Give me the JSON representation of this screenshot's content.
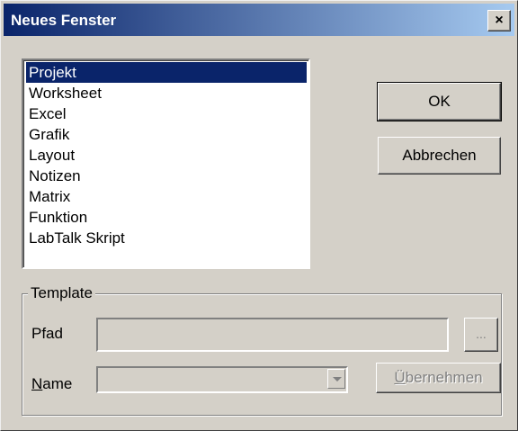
{
  "window": {
    "title": "Neues Fenster",
    "close_symbol": "×"
  },
  "list": {
    "items": [
      {
        "label": "Projekt",
        "selected": true
      },
      {
        "label": "Worksheet",
        "selected": false
      },
      {
        "label": "Excel",
        "selected": false
      },
      {
        "label": "Grafik",
        "selected": false
      },
      {
        "label": "Layout",
        "selected": false
      },
      {
        "label": "Notizen",
        "selected": false
      },
      {
        "label": "Matrix",
        "selected": false
      },
      {
        "label": "Funktion",
        "selected": false
      },
      {
        "label": "LabTalk Skript",
        "selected": false
      }
    ]
  },
  "buttons": {
    "ok": "OK",
    "cancel": "Abbrechen"
  },
  "template": {
    "group_label": "Template",
    "path_label": "Pfad",
    "path_value": "",
    "browse_label": "...",
    "name_label_first": "N",
    "name_label_rest": "ame",
    "name_value": "",
    "apply_first": "Ü",
    "apply_rest": "bernehmen"
  },
  "colors": {
    "title_bar_start": "#0a246a",
    "title_bar_end": "#a6caf0",
    "selection": "#0a246a",
    "face": "#d4d0c8"
  }
}
